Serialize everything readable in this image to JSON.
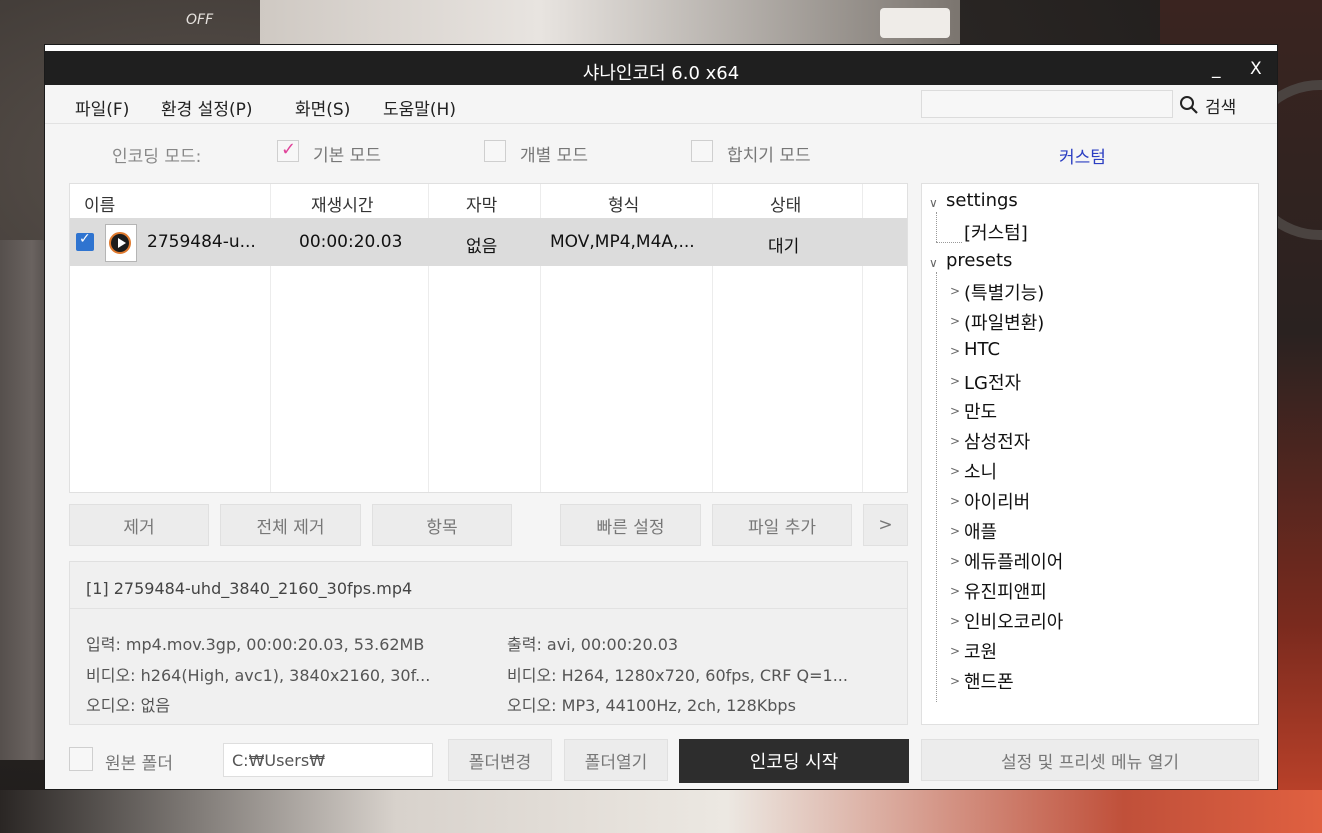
{
  "window": {
    "title": "샤나인코더 6.0 x64",
    "minimize": "_",
    "close": "X"
  },
  "menu": {
    "file": "파일(F)",
    "settings": "환경 설정(P)",
    "screen": "화면(S)",
    "help": "도움말(H)"
  },
  "search": {
    "label": "검색",
    "value": ""
  },
  "encoding_mode": {
    "label": "인코딩 모드:",
    "basic": "기본 모드",
    "basic_checked": true,
    "individual": "개별 모드",
    "individual_checked": false,
    "merge": "합치기 모드",
    "merge_checked": false
  },
  "custom_title": "커스텀",
  "table": {
    "headers": {
      "name": "이름",
      "duration": "재생시간",
      "subtitle": "자막",
      "format": "형식",
      "status": "상태"
    },
    "rows": [
      {
        "checked": true,
        "name": "2759484-u...",
        "duration": "00:00:20.03",
        "subtitle": "없음",
        "format": "MOV,MP4,M4A,...",
        "status": "대기"
      }
    ]
  },
  "actions": {
    "remove": "제거",
    "remove_all": "전체 제거",
    "item": "항목",
    "quick_settings": "빠른 설정",
    "add_file": "파일 추가",
    "more": ">"
  },
  "info": {
    "filename": "[1] 2759484-uhd_3840_2160_30fps.mp4",
    "input": "입력: mp4.mov.3gp, 00:00:20.03, 53.62MB",
    "in_video": "비디오: h264(High, avc1), 3840x2160, 30f...",
    "in_audio": "오디오: 없음",
    "output": "출력: avi, 00:00:20.03",
    "out_video": "비디오: H264, 1280x720, 60fps, CRF Q=1...",
    "out_audio": "오디오: MP3, 44100Hz, 2ch, 128Kbps"
  },
  "bottom": {
    "original_folder": "원본 폴더",
    "original_folder_checked": false,
    "path": "C:₩Users₩",
    "change_folder": "폴더변경",
    "open_folder": "폴더열기",
    "start_encoding": "인코딩 시작",
    "open_menu": "설정 및 프리셋 메뉴 열기"
  },
  "tree": {
    "settings": "settings",
    "settings_children": [
      "[커스텀]"
    ],
    "presets": "presets",
    "presets_children": [
      "(특별기능)",
      "(파일변환)",
      "HTC",
      "LG전자",
      "만도",
      "삼성전자",
      "소니",
      "아이리버",
      "애플",
      "에듀플레이어",
      "유진피앤피",
      "인비오코리아",
      "코원",
      "핸드폰"
    ]
  },
  "background": {
    "text": "OFF"
  },
  "colors": {
    "accent_checkbox": "#e0449a",
    "row_checkbox": "#2f74d0",
    "custom_link": "#2b3ec2",
    "encode_button": "#2d2d2d"
  }
}
